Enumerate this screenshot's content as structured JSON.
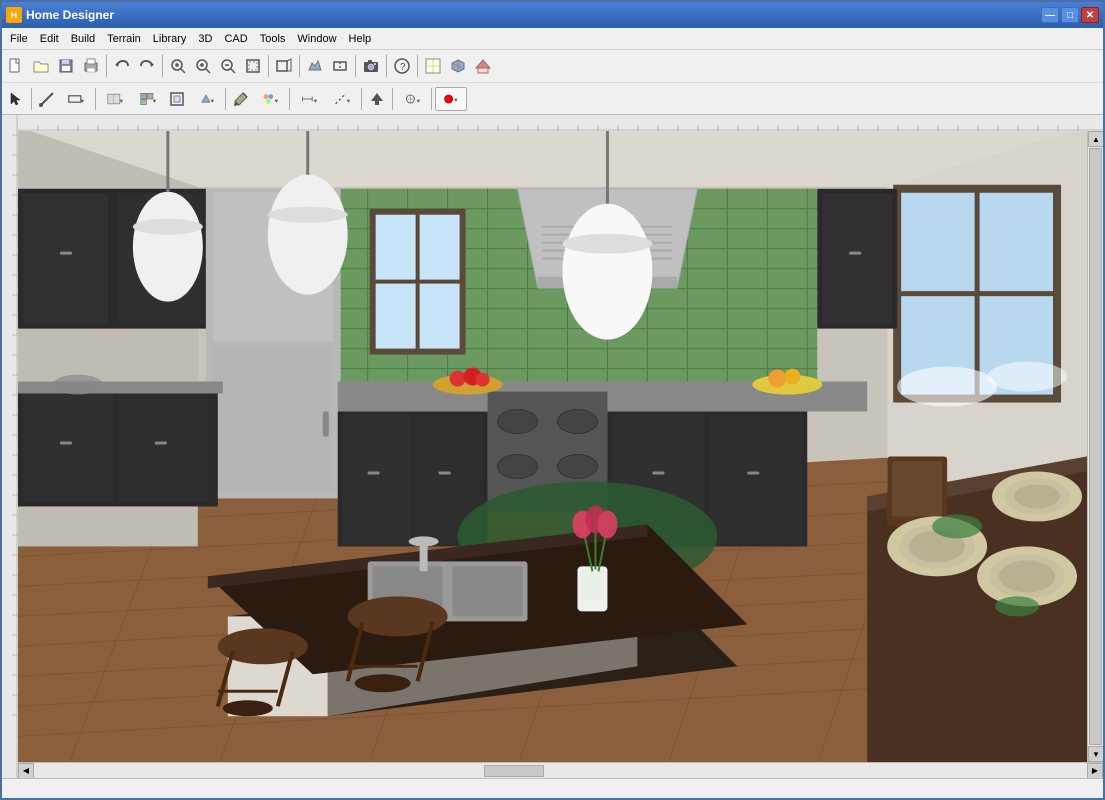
{
  "window": {
    "title": "Home Designer",
    "icon": "🏠"
  },
  "title_bar": {
    "controls": {
      "minimize": "—",
      "maximize": "□",
      "close": "✕"
    }
  },
  "menu": {
    "items": [
      {
        "id": "file",
        "label": "File"
      },
      {
        "id": "edit",
        "label": "Edit"
      },
      {
        "id": "build",
        "label": "Build"
      },
      {
        "id": "terrain",
        "label": "Terrain"
      },
      {
        "id": "library",
        "label": "Library"
      },
      {
        "id": "3d",
        "label": "3D"
      },
      {
        "id": "cad",
        "label": "CAD"
      },
      {
        "id": "tools",
        "label": "Tools"
      },
      {
        "id": "window",
        "label": "Window"
      },
      {
        "id": "help",
        "label": "Help"
      }
    ]
  },
  "toolbar1": {
    "buttons": [
      {
        "id": "new",
        "icon": "📄",
        "label": "New"
      },
      {
        "id": "open",
        "icon": "📂",
        "label": "Open"
      },
      {
        "id": "save",
        "icon": "💾",
        "label": "Save"
      },
      {
        "id": "print",
        "icon": "🖨",
        "label": "Print"
      },
      {
        "id": "undo",
        "icon": "↩",
        "label": "Undo"
      },
      {
        "id": "redo",
        "icon": "↪",
        "label": "Redo"
      },
      {
        "id": "zoom-in",
        "icon": "🔍",
        "label": "Zoom In"
      },
      {
        "id": "zoom-in2",
        "icon": "⊕",
        "label": "Zoom In 2"
      },
      {
        "id": "zoom-out",
        "icon": "⊖",
        "label": "Zoom Out"
      },
      {
        "id": "fit",
        "icon": "⊞",
        "label": "Fit to Window"
      },
      {
        "id": "camera",
        "icon": "📷",
        "label": "Camera"
      },
      {
        "id": "help-btn",
        "icon": "?",
        "label": "Help"
      },
      {
        "id": "wall",
        "icon": "🏠",
        "label": "Wall"
      },
      {
        "id": "roof",
        "icon": "▲",
        "label": "Roof"
      },
      {
        "id": "door",
        "icon": "🚪",
        "label": "Door"
      }
    ]
  },
  "toolbar2": {
    "buttons": [
      {
        "id": "select",
        "icon": "↖",
        "label": "Select"
      },
      {
        "id": "draw-line",
        "icon": "⌐",
        "label": "Draw Line"
      },
      {
        "id": "wall-tool",
        "icon": "⊏",
        "label": "Wall Tool"
      },
      {
        "id": "box-select",
        "icon": "⬚",
        "label": "Box Select"
      },
      {
        "id": "cabinet",
        "icon": "⊞",
        "label": "Cabinet"
      },
      {
        "id": "library-tool",
        "icon": "📦",
        "label": "Library"
      },
      {
        "id": "camera-tool",
        "icon": "📷",
        "label": "Camera"
      },
      {
        "id": "paint",
        "icon": "🖌",
        "label": "Paint"
      },
      {
        "id": "texture",
        "icon": "◫",
        "label": "Texture"
      },
      {
        "id": "material",
        "icon": "◈",
        "label": "Material"
      },
      {
        "id": "arrow-up",
        "icon": "⬆",
        "label": "Arrow Up"
      },
      {
        "id": "transform",
        "icon": "⊹",
        "label": "Transform"
      },
      {
        "id": "record",
        "icon": "⏺",
        "label": "Record"
      }
    ]
  },
  "status_bar": {
    "text": ""
  },
  "scene": {
    "type": "3d_kitchen",
    "description": "3D Kitchen interior view with dark cabinets, green tile backsplash, wood floors, kitchen island with sink"
  }
}
